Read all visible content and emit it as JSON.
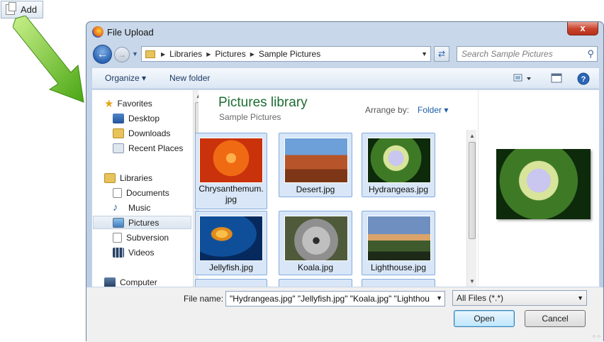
{
  "add_button": {
    "label": "Add"
  },
  "window": {
    "title": "File Upload",
    "close": "x"
  },
  "nav": {
    "breadcrumb": [
      "Libraries",
      "Pictures",
      "Sample Pictures"
    ],
    "search_placeholder": "Search Sample Pictures"
  },
  "toolbar": {
    "organize": "Organize",
    "new_folder": "New folder"
  },
  "sidebar": {
    "favorites": "Favorites",
    "favorite_items": [
      "Desktop",
      "Downloads",
      "Recent Places"
    ],
    "libraries": "Libraries",
    "library_items": [
      "Documents",
      "Music",
      "Pictures",
      "Subversion",
      "Videos"
    ],
    "computer": "Computer"
  },
  "library": {
    "title": "Pictures library",
    "subtitle": "Sample Pictures",
    "arrange_label": "Arrange by:",
    "arrange_value": "Folder",
    "files": [
      {
        "name_line1": "Chrysanthemum.",
        "name_line2": "jpg",
        "image": "chrysanthemum"
      },
      {
        "name_line1": "Desert.jpg",
        "name_line2": "",
        "image": "desert"
      },
      {
        "name_line1": "Hydrangeas.jpg",
        "name_line2": "",
        "image": "hydrangeas"
      },
      {
        "name_line1": "Jellyfish.jpg",
        "name_line2": "",
        "image": "jellyfish"
      },
      {
        "name_line1": "Koala.jpg",
        "name_line2": "",
        "image": "koala"
      },
      {
        "name_line1": "Lighthouse.jpg",
        "name_line2": "",
        "image": "lighthouse"
      }
    ]
  },
  "bottom": {
    "file_name_label": "File name:",
    "file_name_value": "\"Hydrangeas.jpg\" \"Jellyfish.jpg\" \"Koala.jpg\" \"Lighthou",
    "filter": "All Files (*.*)",
    "open": "Open",
    "cancel": "Cancel"
  }
}
